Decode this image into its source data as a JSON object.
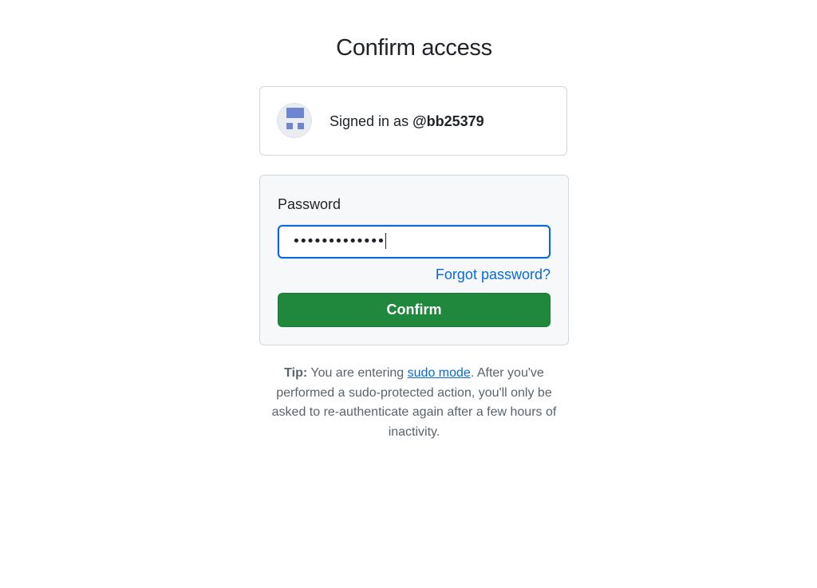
{
  "page": {
    "title": "Confirm access"
  },
  "account": {
    "signed_in_prefix": "Signed in as ",
    "username": "@bb25379",
    "avatar_icon": "identicon",
    "avatar_color": "#6e86cf"
  },
  "form": {
    "password_label": "Password",
    "password_value": "•••••••••••••",
    "forgot_link": "Forgot password?",
    "confirm_label": "Confirm"
  },
  "tip": {
    "label": "Tip:",
    "text_before_link": " You are entering ",
    "link_text": "sudo mode",
    "text_after_link": ". After you've performed a sudo-protected action, you'll only be asked to re-authenticate again after a few hours of inactivity."
  },
  "colors": {
    "primary_button": "#1f883d",
    "link": "#0969da",
    "focus_border": "#0969da",
    "box_border": "#d0d7de",
    "form_background": "#f6f8fa"
  }
}
